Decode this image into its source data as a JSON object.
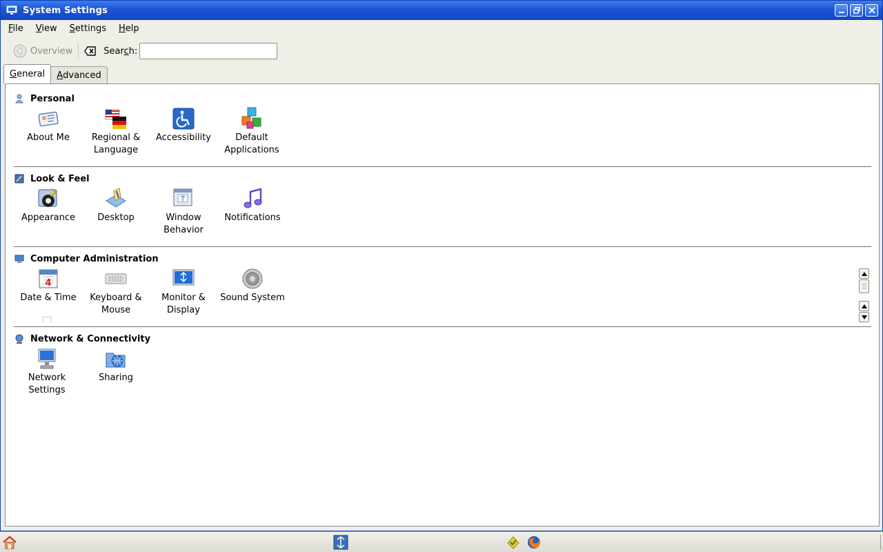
{
  "window": {
    "title": "System Settings"
  },
  "menubar": {
    "items": [
      {
        "label_u": "F",
        "label_rest": "ile"
      },
      {
        "label_u": "V",
        "label_rest": "iew"
      },
      {
        "label_u": "S",
        "label_rest": "ettings"
      },
      {
        "label_u": "H",
        "label_rest": "elp"
      }
    ]
  },
  "toolbar": {
    "overview_label": "Overview",
    "search_label_pre": "Sear",
    "search_label_u": "c",
    "search_label_post": "h:",
    "search_value": ""
  },
  "tabs": [
    {
      "label_u": "G",
      "label_rest": "eneral",
      "active": true
    },
    {
      "label_u": "A",
      "label_rest": "dvanced",
      "active": false
    }
  ],
  "sections": [
    {
      "title": "Personal",
      "icon": "person-icon",
      "items": [
        {
          "line1": "About Me",
          "line2": "",
          "icon": "about-me-icon"
        },
        {
          "line1": "Regional &",
          "line2": "Language",
          "icon": "flags-icon"
        },
        {
          "line1": "Accessibility",
          "line2": "",
          "icon": "accessibility-icon"
        },
        {
          "line1": "Default",
          "line2": "Applications",
          "icon": "cubes-icon"
        }
      ]
    },
    {
      "title": "Look & Feel",
      "icon": "look-feel-icon",
      "items": [
        {
          "line1": "Appearance",
          "line2": "",
          "icon": "appearance-icon"
        },
        {
          "line1": "Desktop",
          "line2": "",
          "icon": "desktop-icon"
        },
        {
          "line1": "Window",
          "line2": "Behavior",
          "icon": "window-behavior-icon"
        },
        {
          "line1": "Notifications",
          "line2": "",
          "icon": "music-note-icon"
        }
      ]
    },
    {
      "title": "Computer Administration",
      "icon": "computer-icon",
      "items": [
        {
          "line1": "Date & Time",
          "line2": "",
          "icon": "calendar-icon"
        },
        {
          "line1": "Keyboard &",
          "line2": "Mouse",
          "icon": "keyboard-icon"
        },
        {
          "line1": "Monitor &",
          "line2": "Display",
          "icon": "monitor-icon"
        },
        {
          "line1": "Sound System",
          "line2": "",
          "icon": "speaker-icon"
        }
      ]
    },
    {
      "title": "Network & Connectivity",
      "icon": "network-icon",
      "items": [
        {
          "line1": "Network",
          "line2": "Settings",
          "icon": "network-settings-icon"
        },
        {
          "line1": "Sharing",
          "line2": "",
          "icon": "sharing-icon"
        }
      ]
    }
  ],
  "colors": {
    "titlebar": "#1a55d6",
    "window_bg": "#efefe7",
    "panel_bg": "#ffffff"
  }
}
